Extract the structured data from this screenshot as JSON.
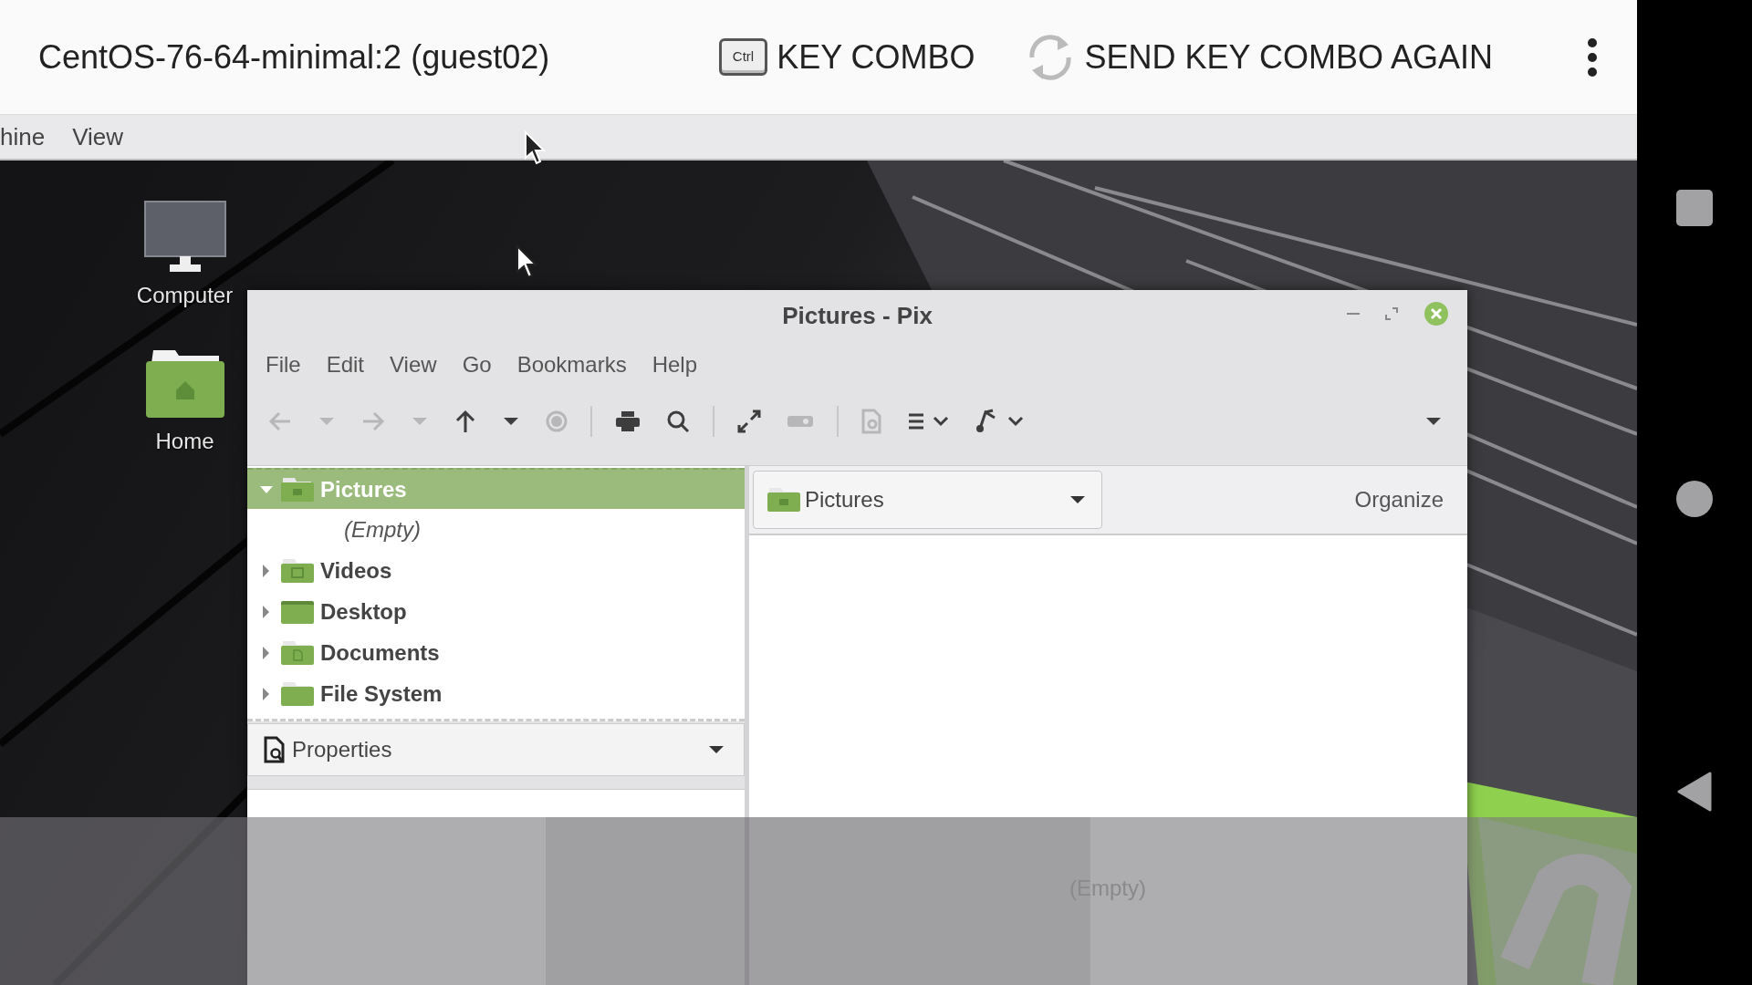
{
  "app_bar": {
    "title": "CentOS-76-64-minimal:2 (guest02)",
    "key_label": "Ctrl",
    "actions": [
      {
        "kind": "keys",
        "label": "KEY COMBO"
      },
      {
        "kind": "resend",
        "label": "SEND KEY COMBO AGAIN"
      }
    ]
  },
  "vm_menu": [
    "hine",
    "View"
  ],
  "desktop_icons": [
    {
      "kind": "computer",
      "label": "Computer"
    },
    {
      "kind": "home",
      "label": "Home"
    }
  ],
  "window": {
    "title": "Pictures - Pix",
    "menu": [
      "File",
      "Edit",
      "View",
      "Go",
      "Bookmarks",
      "Help"
    ],
    "toolbar": [
      {
        "kind": "back",
        "disabled": true
      },
      {
        "kind": "dropdown",
        "disabled": true
      },
      {
        "kind": "forward",
        "disabled": true
      },
      {
        "kind": "dropdown",
        "disabled": true
      },
      {
        "kind": "up",
        "disabled": false
      },
      {
        "kind": "dropdown",
        "disabled": false
      },
      {
        "kind": "record",
        "disabled": true
      },
      {
        "kind": "separator"
      },
      {
        "kind": "print",
        "disabled": false
      },
      {
        "kind": "search",
        "disabled": false
      },
      {
        "kind": "separator"
      },
      {
        "kind": "fullscreen",
        "disabled": false
      },
      {
        "kind": "slideshow",
        "disabled": true
      },
      {
        "kind": "separator"
      },
      {
        "kind": "properties",
        "disabled": true
      },
      {
        "kind": "list",
        "disabled": false
      },
      {
        "kind": "tools",
        "disabled": false
      }
    ],
    "tree": [
      {
        "kind": "pictures",
        "label": "Pictures",
        "selected": true,
        "expanded": true,
        "children": [
          {
            "kind": "empty",
            "label": "(Empty)",
            "selected": false
          }
        ]
      },
      {
        "kind": "videos",
        "label": "Videos",
        "selected": false,
        "expanded": false
      },
      {
        "kind": "desktop",
        "label": "Desktop",
        "selected": false,
        "expanded": false
      },
      {
        "kind": "documents",
        "label": "Documents",
        "selected": false,
        "expanded": false
      },
      {
        "kind": "drive",
        "label": "File System",
        "selected": false,
        "expanded": false
      }
    ],
    "properties_label": "Properties",
    "location": "Pictures",
    "organize": "Organize",
    "empty_label": "(Empty)"
  }
}
